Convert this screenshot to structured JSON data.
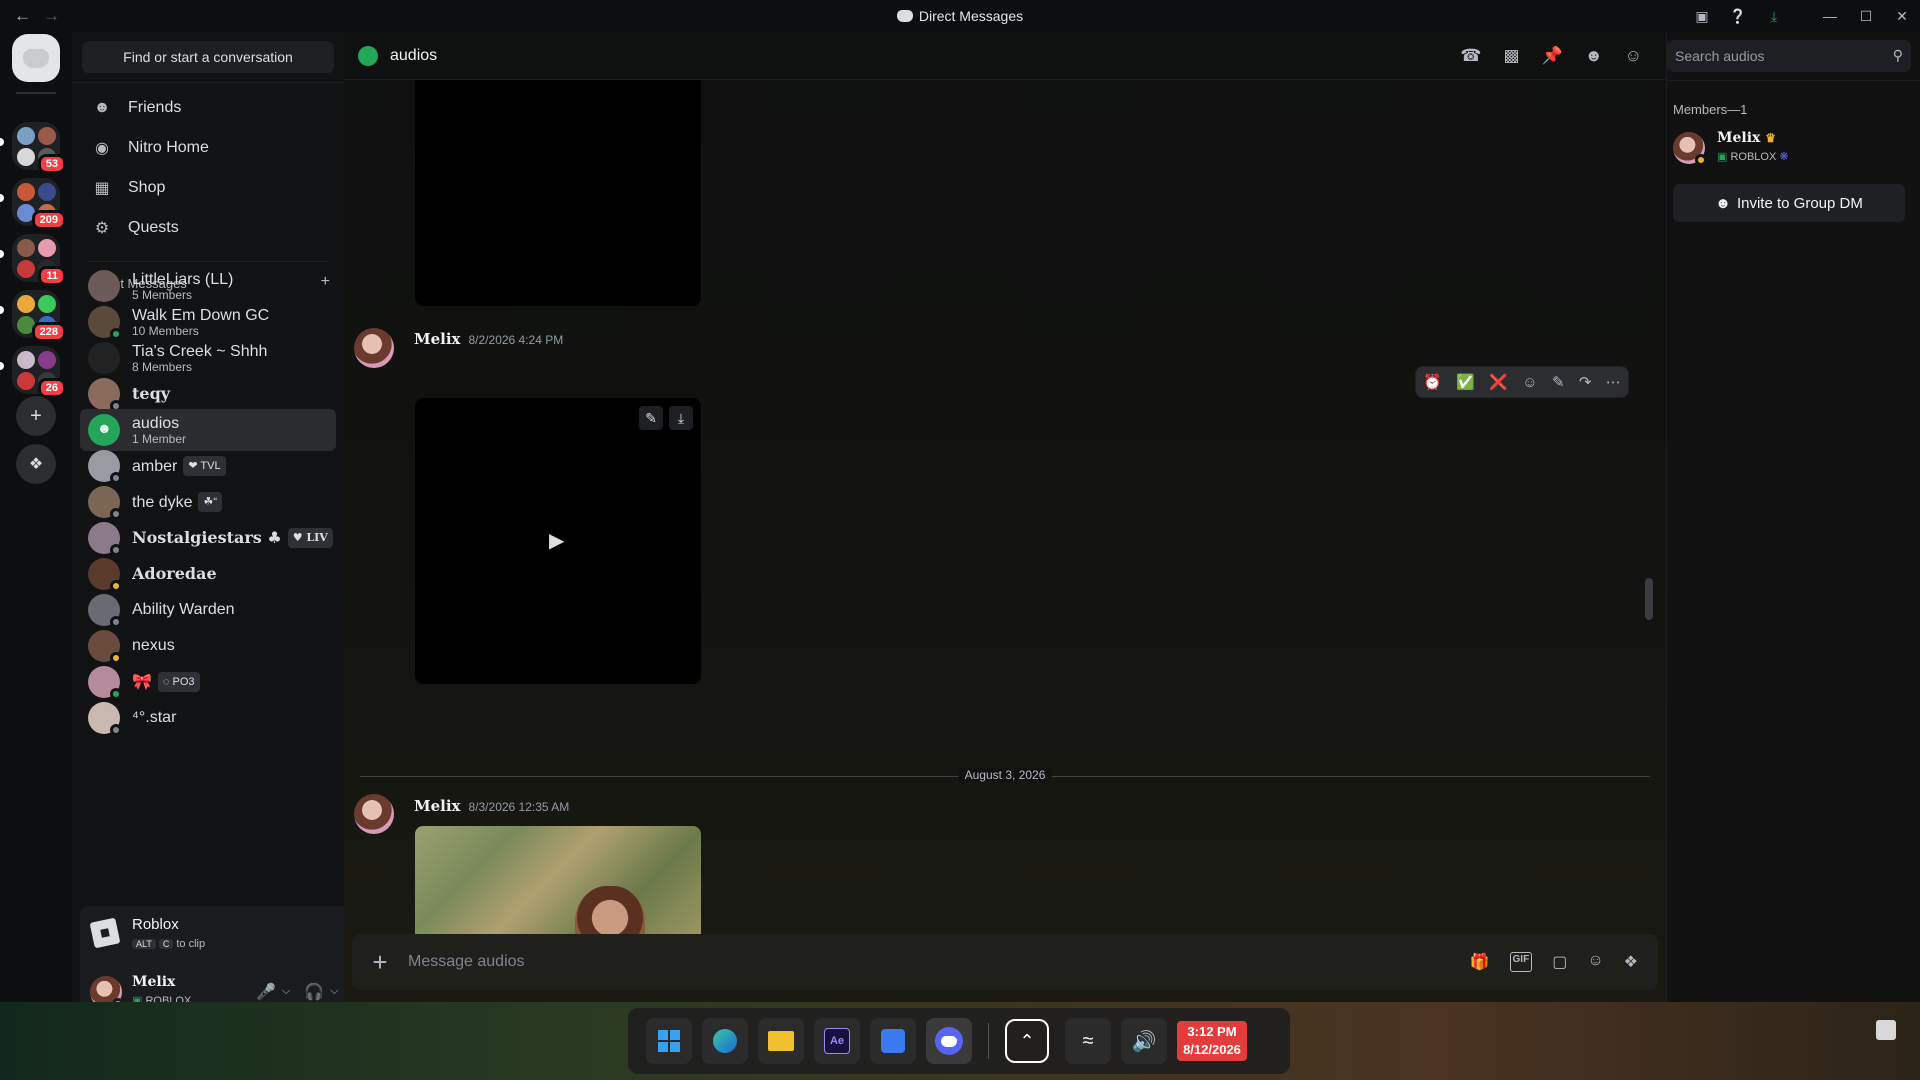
{
  "window": {
    "title": "Direct Messages"
  },
  "servers": [
    {
      "badge": "53"
    },
    {
      "badge": "209"
    },
    {
      "badge": "11"
    },
    {
      "badge": "228"
    },
    {
      "badge": "26"
    }
  ],
  "sidebar": {
    "find_label": "Find or start a conversation",
    "nav": [
      {
        "label": "Friends",
        "icon": "friends-icon"
      },
      {
        "label": "Nitro Home",
        "icon": "nitro-icon"
      },
      {
        "label": "Shop",
        "icon": "shop-icon"
      },
      {
        "label": "Quests",
        "icon": "quests-icon"
      }
    ],
    "dm_header": "Direct Messages",
    "dms": [
      {
        "name": "LittleLiars (LL)",
        "sub": "5 Members",
        "tag": "",
        "status": "",
        "color": "#6b5a58",
        "gothic": false
      },
      {
        "name": "Walk Em Down GC",
        "sub": "10 Members",
        "tag": "",
        "status": "#23a55a",
        "color": "#5a4a3a",
        "gothic": false
      },
      {
        "name": "Tia's Creek ~ Shhh",
        "sub": "8 Members",
        "tag": "",
        "status": "",
        "color": "#222",
        "gothic": false
      },
      {
        "name": "teqy",
        "sub": "",
        "tag": "",
        "status": "#80848e",
        "color": "#8a6a5a",
        "gothic": true
      },
      {
        "name": "audios",
        "sub": "1 Member",
        "tag": "",
        "status": "",
        "color": "#23a55a",
        "gothic": false,
        "selected": true
      },
      {
        "name": "amber",
        "sub": "",
        "tag": "❤ TVL",
        "status": "#80848e",
        "color": "#9a9aa2",
        "gothic": false
      },
      {
        "name": "the dyke",
        "sub": "",
        "tag": "☘“",
        "status": "#80848e",
        "color": "#7a6652",
        "gothic": false
      },
      {
        "name": "Nostalgiestars ♣",
        "sub": "",
        "tag": "♥ LIV",
        "status": "#80848e",
        "color": "#8a7a8a",
        "gothic": true
      },
      {
        "name": "Adoredae",
        "sub": "",
        "tag": "",
        "status": "#f0b232",
        "color": "#5a3a2a",
        "gothic": true
      },
      {
        "name": "Ability Warden",
        "sub": "",
        "tag": "",
        "status": "#80848e",
        "color": "#6a6a72",
        "gothic": false
      },
      {
        "name": "nexus",
        "sub": "",
        "tag": "",
        "status": "#f0b232",
        "color": "#6a4a3a",
        "gothic": false
      },
      {
        "name": "🎀",
        "sub": "",
        "tag": "◌ PO3",
        "status": "#23a55a",
        "color": "#b58a9a",
        "gothic": false
      },
      {
        "name": "⁴°.star",
        "sub": "",
        "tag": "",
        "status": "#80848e",
        "color": "#c9b8b0",
        "gothic": false
      }
    ],
    "activity": {
      "title": "Roblox",
      "key1": "ALT",
      "key2": "C",
      "hint": "to clip"
    },
    "user": {
      "name": "Melix",
      "status": "ROBLOX"
    }
  },
  "channel": {
    "name": "audios",
    "icons": [
      "phone-icon",
      "video-icon",
      "pin-icon",
      "add-member-icon",
      "members-icon"
    ],
    "search_placeholder": "Search audios"
  },
  "messages": [
    {
      "author": "Melix",
      "time": "8/2/2026 4:24 PM"
    },
    {
      "author": "Melix",
      "time": "8/3/2026 12:35 AM"
    }
  ],
  "date_divider": "August 3, 2026",
  "hover_toolbar": [
    "⏰",
    "✅",
    "❌",
    "☺",
    "✎",
    "↷",
    "⋯"
  ],
  "composer": {
    "placeholder": "Message audios"
  },
  "members_panel": {
    "header": "Members—1",
    "member_name": "Melix",
    "member_status": "ROBLOX",
    "invite_label": "Invite to Group DM"
  },
  "taskbar": {
    "time": "3:12 PM",
    "date": "8/12/2026"
  }
}
